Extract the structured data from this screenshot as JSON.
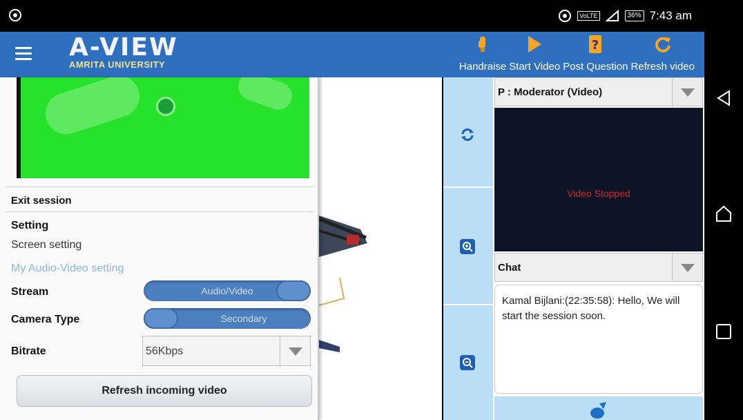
{
  "status_bar": {
    "time": "7:43 am",
    "battery": "36%",
    "network": "VoLTE"
  },
  "app_bar": {
    "brand_title": "A-VIEW",
    "brand_subtitle": "AMRITA UNIVERSITY",
    "actions": [
      {
        "label": "Handraise",
        "icon": "hand-icon"
      },
      {
        "label": "Start Video",
        "icon": "play-icon"
      },
      {
        "label": "Post Question",
        "icon": "question-icon"
      },
      {
        "label": "Refresh video",
        "icon": "refresh-icon"
      }
    ]
  },
  "drawer": {
    "exit_session": "Exit session",
    "setting_header": "Setting",
    "screen_setting": "Screen setting",
    "av_setting": "My Audio-Video setting",
    "stream_label": "Stream",
    "stream_value": "Audio/Video",
    "camera_label": "Camera Type",
    "camera_value": "Secondary",
    "bitrate_label": "Bitrate",
    "bitrate_value": "56Kbps",
    "refresh_button": "Refresh incoming video"
  },
  "panel": {
    "video_source": "P : Moderator (Video)",
    "video_status": "Video Stopped",
    "chat_label": "Chat",
    "chat_message": "Kamal Bijlani:(22:35:58): Hello, We will start the session soon."
  },
  "colors": {
    "app_bar": "#2f6fc0",
    "preview_green": "#27e22b",
    "control_blue": "#b9def6",
    "video_stopped_red": "#d2252a"
  }
}
